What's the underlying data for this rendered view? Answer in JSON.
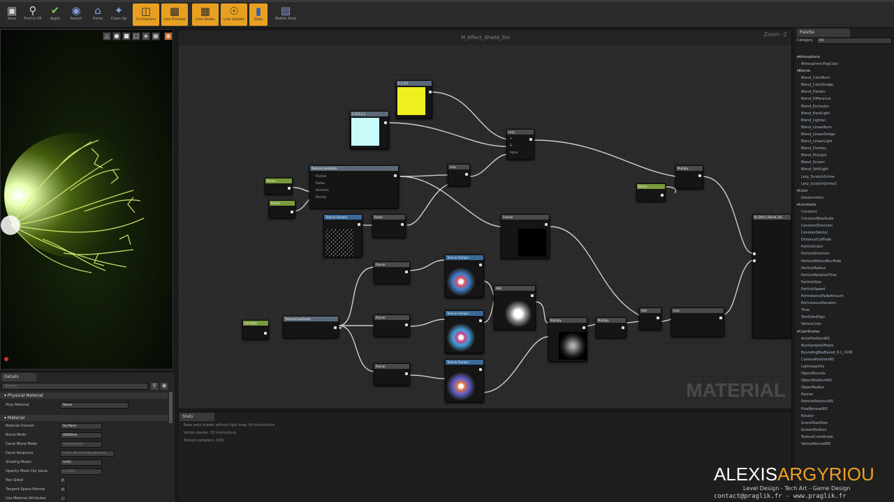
{
  "toolbar": {
    "buttons": [
      {
        "label": "Save",
        "icon": "save-icon"
      },
      {
        "label": "Find in CB",
        "icon": "search-icon"
      },
      {
        "label": "Apply",
        "icon": "check-icon"
      },
      {
        "label": "Search",
        "icon": "binoculars-icon"
      },
      {
        "label": "Home",
        "icon": "home-icon"
      },
      {
        "label": "Clean Up",
        "icon": "broom-icon"
      },
      {
        "label": "Connectors",
        "icon": "connectors-icon"
      },
      {
        "label": "Live Preview",
        "icon": "monitor-icon"
      },
      {
        "label": "Live Nodes",
        "icon": "nodes-icon"
      },
      {
        "label": "Live Update",
        "icon": "update-icon"
      },
      {
        "label": "Stats",
        "icon": "stats-icon"
      },
      {
        "label": "Mobile Stats",
        "icon": "mobile-stats-icon"
      }
    ],
    "accent": "#e8a021"
  },
  "graph": {
    "title": "M_Effect_Shield_Sto",
    "zoom": "Zoom -2",
    "watermark": "MATERIAL",
    "nodes": {
      "color_yellow": "0,1,0,0",
      "color_cyan": "0.533,1,1",
      "lerp1": "Lerp",
      "lerp2": "Lerp",
      "add": "Add",
      "multiply": "Multiply",
      "texture_coord": "TextureCoordinate",
      "panner1": "Panner",
      "panner2": "Panner",
      "panner3": "Panner",
      "tex_sample1": "Texture Sample",
      "tex_sample2": "Texture Sample",
      "tex_sample3": "Texture Sample",
      "tex_noise": "Texture Sample",
      "param1": "Param",
      "param2": "Param",
      "param3": "Param",
      "constant": "Constant",
      "power": "Power",
      "fresnel": "Fresnel",
      "output": "M_Effect_Shield_Sto"
    }
  },
  "details": {
    "tab": "Details",
    "search_placeholder": "Search",
    "section_physical": "Physical Material",
    "phys_label": "Phys Material",
    "phys_value": "None",
    "section_material": "Material",
    "props": [
      {
        "label": "Material Domain",
        "value": "Surface"
      },
      {
        "label": "Blend Mode",
        "value": "Additive"
      },
      {
        "label": "Decal Blend Mode",
        "value": "Translucent"
      },
      {
        "label": "Decal Response",
        "value": "Color Normal Roughness"
      },
      {
        "label": "Shading Model",
        "value": "Unlit"
      },
      {
        "label": "Opacity Mask Clip Value",
        "value": "0.3333"
      },
      {
        "label": "Two Sided",
        "value": ""
      },
      {
        "label": "Tangent Space Normal",
        "value": ""
      },
      {
        "label": "Use Material Attributes",
        "value": ""
      }
    ]
  },
  "output": {
    "tab": "Stats",
    "lines": [
      "Base pass shader without light map: 64 instructions",
      "Vertex shader: 33 instructions",
      "Texture samplers: 4/16"
    ]
  },
  "palette": {
    "tab": "Palette",
    "category_label": "Category",
    "category_value": "All",
    "categories": [
      {
        "name": "Atmosphere",
        "items": [
          "AtmosphericFogColor"
        ]
      },
      {
        "name": "Blends",
        "items": [
          "Blend_ColorBurn",
          "Blend_ColorDodge",
          "Blend_Darken",
          "Blend_Difference",
          "Blend_Exclusion",
          "Blend_HardLight",
          "Blend_Lighten",
          "Blend_LinearBurn",
          "Blend_LinearDodge",
          "Blend_LinearLight",
          "Blend_Overlay",
          "Blend_PinLight",
          "Blend_Screen",
          "Blend_SoftLight",
          "Lerp_ScratchGrime",
          "Lerp_ScratchGrime2"
        ]
      },
      {
        "name": "Color",
        "items": [
          "Desaturation"
        ]
      },
      {
        "name": "Constants",
        "items": [
          "Constant",
          "ConstantBiasScale",
          "ConstantDirection",
          "ConstantVector",
          "DistanceCullFade",
          "ParticleColor",
          "ParticleDirection",
          "ParticleMotionBlurFade",
          "ParticleRadius",
          "ParticleRelativeTime",
          "ParticleSize",
          "ParticleSpeed",
          "PerInstanceFadeAmount",
          "PerInstanceRandom",
          "Time",
          "TwoSidedSign",
          "VertexColor"
        ]
      },
      {
        "name": "Coordinates",
        "items": [
          "ActorPositionWS",
          "BlurSampleOffsets",
          "BoundingBoxBased_0-1_UVW",
          "CameraPositionWS",
          "LightmapUVs",
          "ObjectBounds",
          "ObjectPositionWS",
          "ObjectRadius",
          "Panner",
          "ParticlePositionWS",
          "PixelNormalWS",
          "Rotator",
          "SceneTexelSize",
          "ScreenPosition",
          "TextureCoordinate",
          "VertexNormalWS"
        ]
      }
    ]
  },
  "signature": {
    "first": "ALEXIS",
    "last": "ARGYRIOU",
    "subtitle": "Level Design - Tech Art - Game Design",
    "contact": "contact@praglik.fr - www.praglik.fr"
  }
}
